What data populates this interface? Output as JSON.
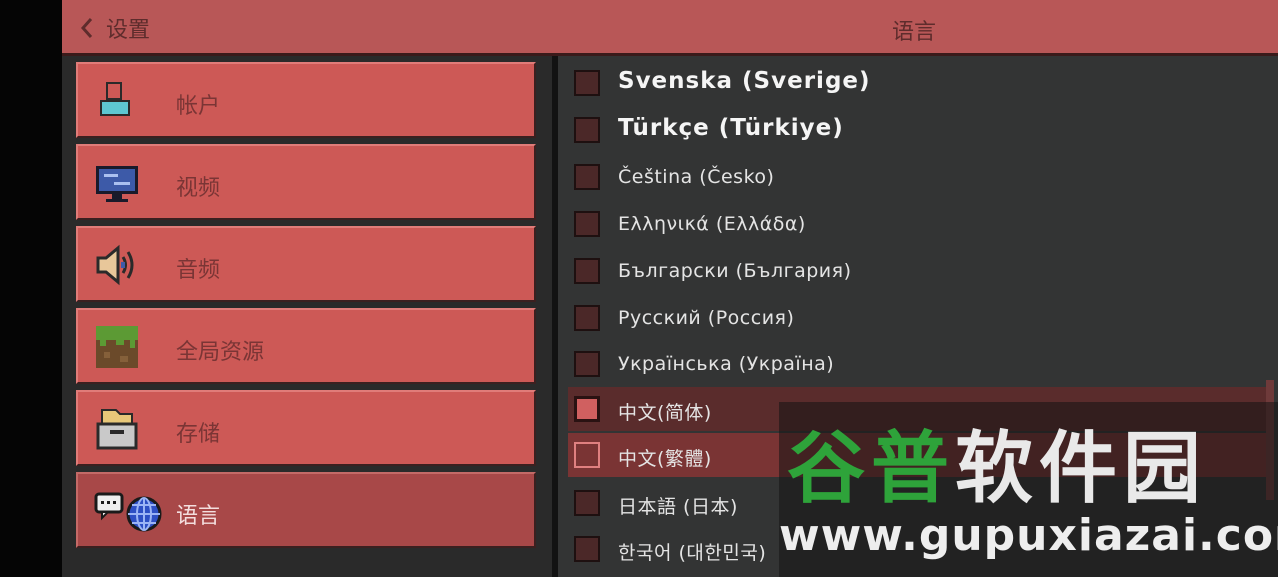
{
  "header": {
    "back_label": "设置",
    "title": "语言"
  },
  "sidebar": {
    "items": [
      {
        "label": "帐户",
        "icon": "account-icon",
        "active": false
      },
      {
        "label": "视频",
        "icon": "video-icon",
        "active": false
      },
      {
        "label": "音频",
        "icon": "audio-icon",
        "active": false
      },
      {
        "label": "全局资源",
        "icon": "global-resources-icon",
        "active": false
      },
      {
        "label": "存储",
        "icon": "storage-icon",
        "active": false
      },
      {
        "label": "语言",
        "icon": "language-icon",
        "active": true
      }
    ]
  },
  "languages": {
    "items": [
      {
        "label": "Svenska (Sverige)",
        "state": "unchecked"
      },
      {
        "label": "Türkçe (Türkiye)",
        "state": "unchecked"
      },
      {
        "label": "Čeština (Česko)",
        "state": "unchecked"
      },
      {
        "label": "Ελληνικά (Ελλάδα)",
        "state": "unchecked"
      },
      {
        "label": "Български (България)",
        "state": "unchecked"
      },
      {
        "label": "Русский (Россия)",
        "state": "unchecked"
      },
      {
        "label": "Українська (Україна)",
        "state": "unchecked"
      },
      {
        "label": "中文(简体)",
        "state": "checked"
      },
      {
        "label": "中文(繁體)",
        "state": "hover"
      },
      {
        "label": "日本語 (日本)",
        "state": "unchecked"
      },
      {
        "label": "한국어 (대한민국)",
        "state": "unchecked"
      }
    ]
  },
  "watermark": {
    "text_green": "谷普",
    "text_white": "软件园",
    "url": "www.gupuxiazai.com"
  },
  "colors": {
    "accent": "#cd5956",
    "header": "#b85757",
    "panel": "#333434",
    "watermark_green": "#2ea33a"
  }
}
